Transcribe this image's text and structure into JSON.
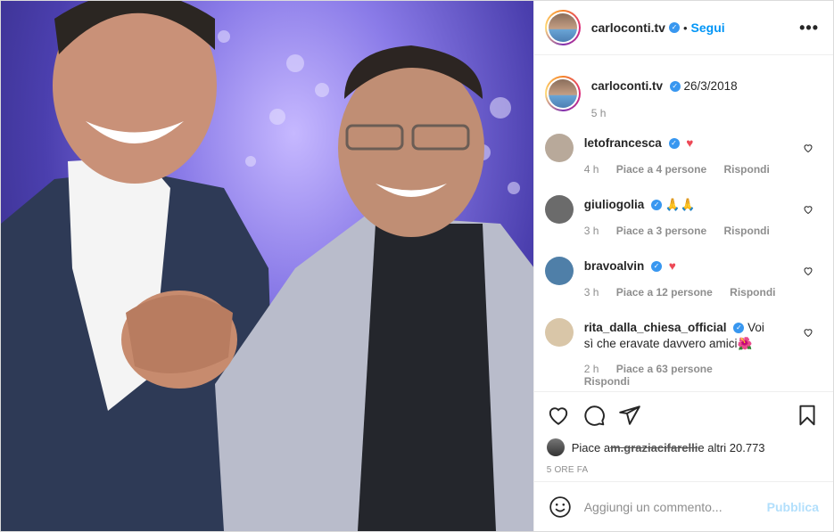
{
  "post": {
    "author": "carloconti.tv",
    "follow_label": "Segui",
    "dot": "•",
    "more_label": "•••"
  },
  "caption": {
    "author": "carloconti.tv",
    "text": "26/3/2018",
    "time": "5 h"
  },
  "comments": [
    {
      "user": "letofrancesca",
      "text": "",
      "emoji": "♥",
      "time": "4 h",
      "likes": "Piace a 4 persone",
      "reply": "Rispondi",
      "avatar_color": "#b8a99a"
    },
    {
      "user": "giuliogolia",
      "text": "🙏🙏",
      "emoji": "",
      "time": "3 h",
      "likes": "Piace a 3 persone",
      "reply": "Rispondi",
      "avatar_color": "#6b6b6b"
    },
    {
      "user": "bravoalvin",
      "text": "",
      "emoji": "♥",
      "time": "3 h",
      "likes": "Piace a 12 persone",
      "reply": "Rispondi",
      "avatar_color": "#4f7fa8"
    },
    {
      "user": "rita_dalla_chiesa_official",
      "text": "Voi sì che eravate davvero amici🌺",
      "emoji": "",
      "time": "2 h",
      "likes": "Piace a 63 persone",
      "reply": "Rispondi",
      "avatar_color": "#d9c6a8"
    }
  ],
  "likes_line": {
    "prefix": "Piace a ",
    "user": "m.graziacifarelli",
    "suffix": " e altri 20.773"
  },
  "post_time": "5 ore fa",
  "add_comment": {
    "placeholder": "Aggiungi un commento...",
    "publish": "Pubblica"
  },
  "colors": {
    "accent": "#0095f6",
    "heart": "#ed4956",
    "verified": "#3897f0"
  },
  "icons": [
    "heart-icon",
    "comment-icon",
    "share-icon",
    "bookmark-icon",
    "emoji-icon",
    "more-options-icon",
    "verified-badge-icon"
  ]
}
